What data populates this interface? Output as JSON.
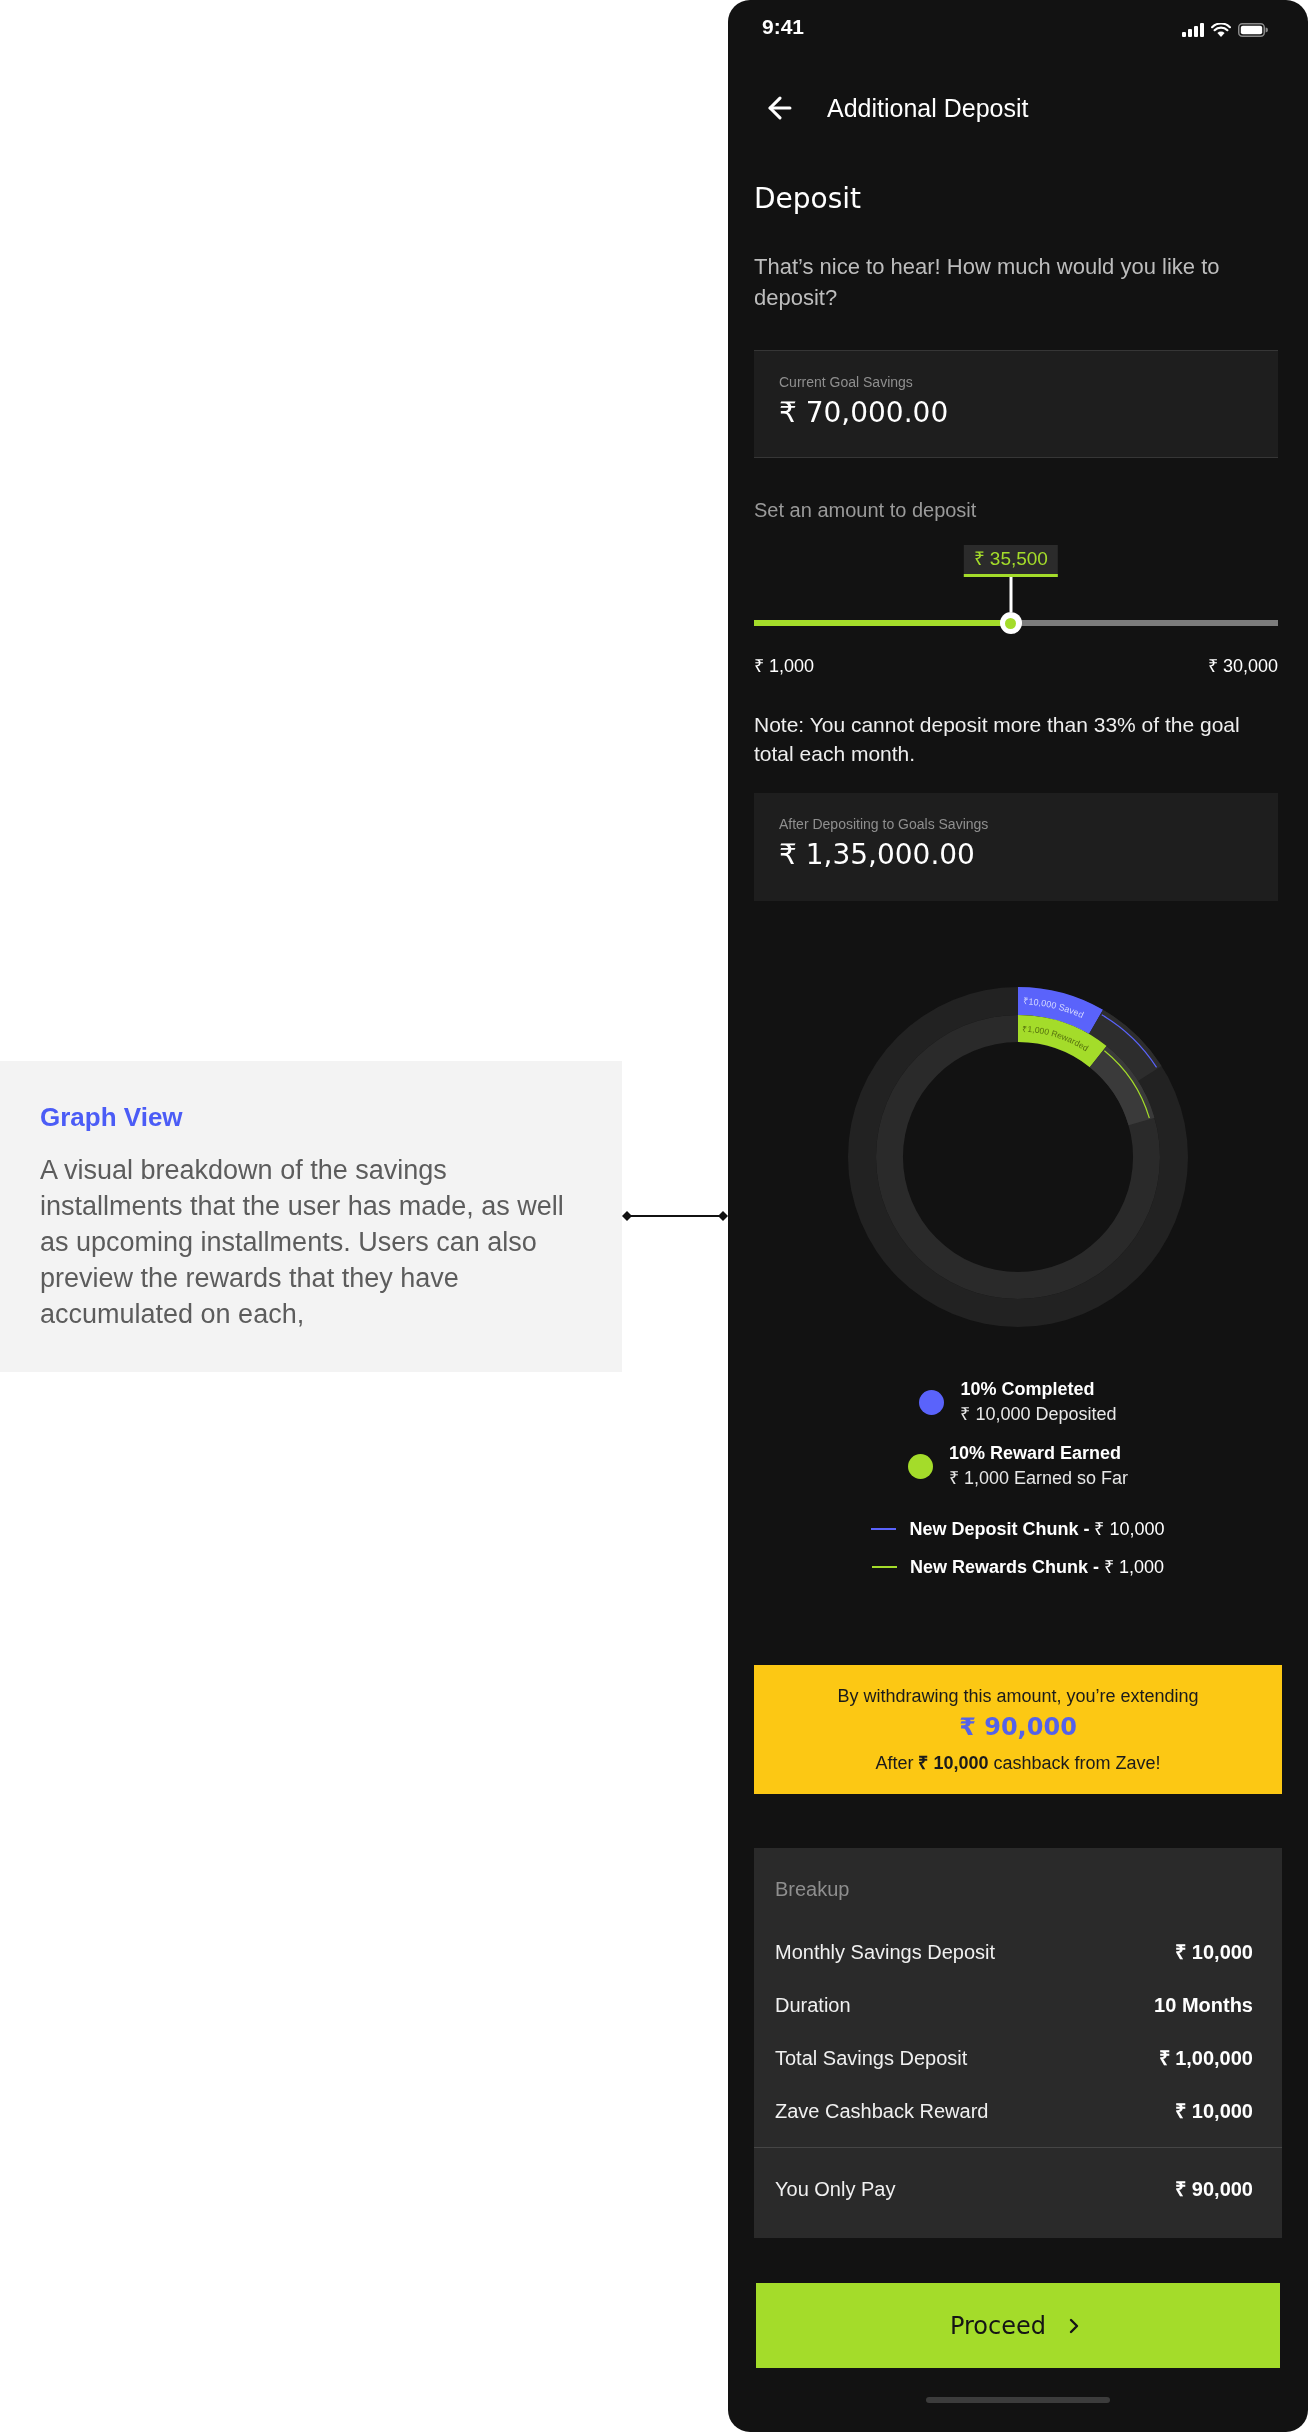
{
  "annotation": {
    "title": "Graph View",
    "body": "A visual breakdown of the savings installments that the user has made, as well as upcoming installments. Users can also preview the rewards that they have accumulated on each,"
  },
  "status_bar": {
    "time": "9:41"
  },
  "header": {
    "title": "Additional Deposit"
  },
  "heading": "Deposit",
  "prompt": "That’s nice to hear! How much would you like to deposit?",
  "current_savings": {
    "label": "Current Goal Savings",
    "value": "₹ 70,000.00"
  },
  "slider": {
    "label": "Set an amount to deposit",
    "value": "₹ 35,500",
    "level": 0.49,
    "min": "₹ 1,000",
    "max": "₹ 30,000"
  },
  "note": "Note: You cannot deposit more than 33% of the goal total each month.",
  "after_deposit": {
    "label": "After Depositing to Goals Savings",
    "value": "₹ 1,35,000.00"
  },
  "donut": {
    "rings": [
      {
        "kind": "deposit",
        "label": "₹10,000 Saved",
        "color": "#5a63fb"
      },
      {
        "kind": "reward",
        "label": "₹1,000 Rewarded",
        "color": "#a4dc2a"
      }
    ]
  },
  "legend": [
    {
      "title": "10% Completed",
      "detail": "₹ 10,000 Deposited",
      "color": "#5a63fb"
    },
    {
      "title": "10% Reward Earned",
      "detail": "₹ 1,000 Earned so Far",
      "color": "#a4dc2a"
    }
  ],
  "chunks": [
    {
      "text": "**New Deposit Chunk -** ₹ 10,000",
      "color": "#5a63fb"
    },
    {
      "text": "**New Rewards Chunk -** ₹ 1,000",
      "color": "#a4dc2a"
    }
  ],
  "banner": {
    "line": "By withdrawing this amount, you’re extending",
    "amount": "₹ 90,000",
    "note": "After **₹ 10,000** cashback from Zave!"
  },
  "breakup": {
    "title": "Breakup",
    "rows": [
      {
        "label": "Monthly Savings Deposit",
        "value": "₹ 10,000"
      },
      {
        "label": "Duration",
        "value": "10 Months"
      },
      {
        "label": "Total Savings Deposit",
        "value": "₹ 1,00,000"
      },
      {
        "label": "Zave Cashback Reward",
        "value": "₹ 10,000"
      }
    ],
    "total": {
      "label": "You Only Pay",
      "value": "₹ 90,000"
    }
  },
  "proceed_button": {
    "label": "Proceed"
  }
}
